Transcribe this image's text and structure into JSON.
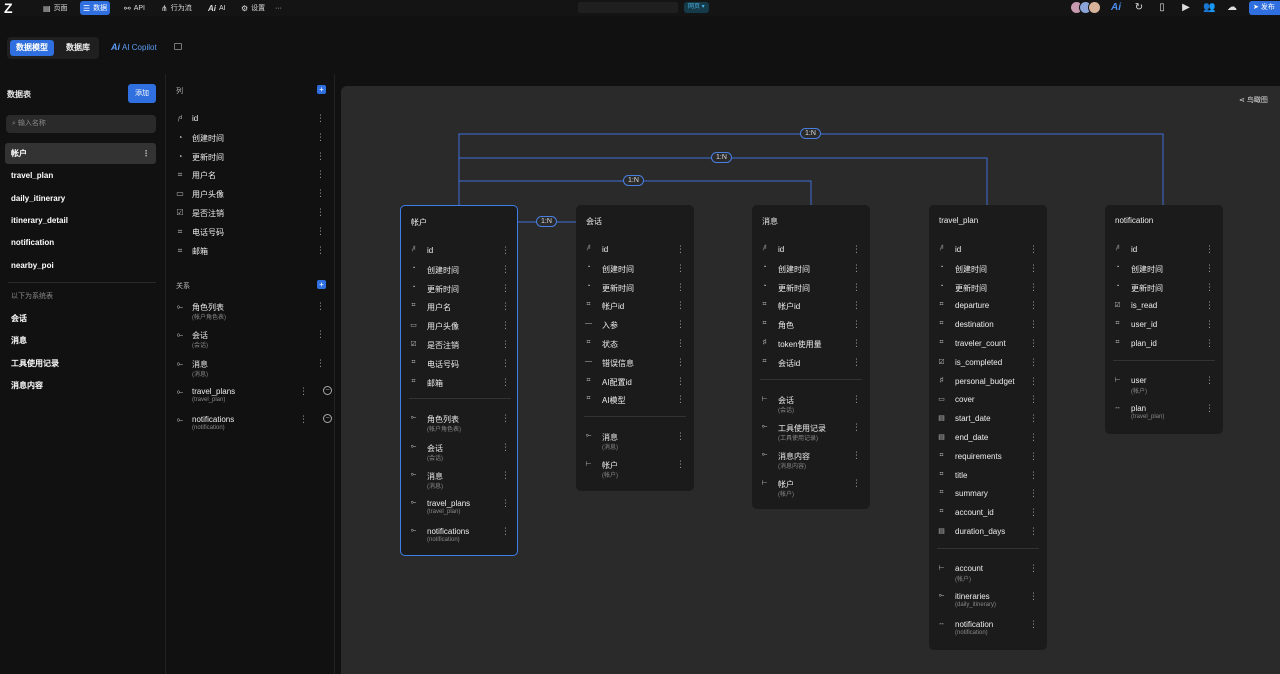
{
  "topbar": {
    "logo": "Z",
    "nav": [
      {
        "id": "page",
        "label": "页面",
        "icon": "layout-icon"
      },
      {
        "id": "data",
        "label": "数据",
        "icon": "database-icon",
        "active": true
      },
      {
        "id": "api",
        "label": "API",
        "icon": "api-icon"
      },
      {
        "id": "flow",
        "label": "行为流",
        "icon": "flow-icon"
      },
      {
        "id": "ai",
        "label": "AI",
        "icon": "ai-icon"
      },
      {
        "id": "settings",
        "label": "设置",
        "icon": "gear-icon"
      }
    ],
    "more": "···",
    "env_badge": "网页",
    "publish_label": "发布",
    "accent": "#2f6fe0"
  },
  "subbar": {
    "tab_model": "数据模型",
    "tab_db": "数据库",
    "copilot_mark": "Ai",
    "copilot_label": "AI Copilot"
  },
  "sidebar": {
    "title": "数据表",
    "add_label": "添加",
    "search_placeholder": "输入名称",
    "tables": [
      "帐户",
      "travel_plan",
      "daily_itinerary",
      "itinerary_detail",
      "notification",
      "nearby_poi"
    ],
    "selected": "帐户",
    "system_note": "以下为系统表",
    "system_tables": [
      "会话",
      "消息",
      "工具使用记录",
      "消息内容"
    ]
  },
  "panel": {
    "columns_title": "列",
    "columns": [
      {
        "icon": "id",
        "name": "id"
      },
      {
        "icon": "time",
        "name": "创建时间"
      },
      {
        "icon": "time",
        "name": "更新时间"
      },
      {
        "icon": "text",
        "name": "用户名"
      },
      {
        "icon": "image",
        "name": "用户头像"
      },
      {
        "icon": "bool",
        "name": "是否注销"
      },
      {
        "icon": "text",
        "name": "电话号码"
      },
      {
        "icon": "text",
        "name": "邮箱"
      }
    ],
    "relations_title": "关系",
    "relations": [
      {
        "name": "角色列表",
        "sub": "(帐户角色表)"
      },
      {
        "name": "会话",
        "sub": "(会话)"
      },
      {
        "name": "消息",
        "sub": "(消息)"
      },
      {
        "name": "travel_plans",
        "sub": "(travel_plan)",
        "removable": true
      },
      {
        "name": "notifications",
        "sub": "(notification)",
        "removable": true
      }
    ]
  },
  "canvas": {
    "birdseye_label": "鸟瞰图",
    "edge_color": "#3d6fd8",
    "badges": [
      "1:N",
      "1:N",
      "1:N",
      "1:N"
    ]
  },
  "cards": [
    {
      "title": "帐户",
      "selected": true,
      "fields": [
        [
          "id",
          "id"
        ],
        [
          "time",
          "创建时间"
        ],
        [
          "time",
          "更新时间"
        ],
        [
          "text",
          "用户名"
        ],
        [
          "image",
          "用户头像"
        ],
        [
          "bool",
          "是否注销"
        ],
        [
          "text",
          "电话号码"
        ],
        [
          "text",
          "邮箱"
        ]
      ],
      "relations": [
        [
          "rel",
          "角色列表",
          "(帐户角色表)"
        ],
        [
          "rel",
          "会话",
          "(会话)"
        ],
        [
          "rel",
          "消息",
          "(消息)"
        ],
        [
          "rel",
          "travel_plans",
          "(travel_plan)"
        ],
        [
          "rel",
          "notifications",
          "(notification)"
        ]
      ]
    },
    {
      "title": "会话",
      "fields": [
        [
          "id",
          "id"
        ],
        [
          "time",
          "创建时间"
        ],
        [
          "time",
          "更新时间"
        ],
        [
          "text",
          "帐户id"
        ],
        [
          "dash",
          "入参"
        ],
        [
          "text",
          "状态"
        ],
        [
          "dash",
          "错误信息"
        ],
        [
          "text",
          "AI配置id"
        ],
        [
          "text",
          "AI模型"
        ]
      ],
      "relations": [
        [
          "rel",
          "消息",
          "(消息)"
        ],
        [
          "ref",
          "帐户",
          "(帐户)"
        ]
      ]
    },
    {
      "title": "消息",
      "fields": [
        [
          "id",
          "id"
        ],
        [
          "time",
          "创建时间"
        ],
        [
          "time",
          "更新时间"
        ],
        [
          "text",
          "帐户id"
        ],
        [
          "text",
          "角色"
        ],
        [
          "num",
          "token使用量"
        ],
        [
          "text",
          "会话id"
        ]
      ],
      "relations": [
        [
          "ref",
          "会话",
          "(会话)"
        ],
        [
          "rel",
          "工具使用记录",
          "(工具使用记录)"
        ],
        [
          "rel",
          "消息内容",
          "(消息内容)"
        ],
        [
          "ref",
          "帐户",
          "(帐户)"
        ]
      ]
    },
    {
      "title": "travel_plan",
      "fields": [
        [
          "id",
          "id"
        ],
        [
          "time",
          "创建时间"
        ],
        [
          "time",
          "更新时间"
        ],
        [
          "text",
          "departure"
        ],
        [
          "text",
          "destination"
        ],
        [
          "text",
          "traveler_count"
        ],
        [
          "bool",
          "is_completed"
        ],
        [
          "num",
          "personal_budget"
        ],
        [
          "image",
          "cover"
        ],
        [
          "date",
          "start_date"
        ],
        [
          "date",
          "end_date"
        ],
        [
          "text",
          "requirements"
        ],
        [
          "text",
          "title"
        ],
        [
          "text",
          "summary"
        ],
        [
          "text",
          "account_id"
        ],
        [
          "date",
          "duration_days"
        ]
      ],
      "relations": [
        [
          "ref",
          "account",
          "(帐户)"
        ],
        [
          "rel",
          "itineraries",
          "(daily_itinerary)"
        ],
        [
          "link",
          "notification",
          "(notification)"
        ]
      ]
    },
    {
      "title": "notification",
      "fields": [
        [
          "id",
          "id"
        ],
        [
          "time",
          "创建时间"
        ],
        [
          "time",
          "更新时间"
        ],
        [
          "bool",
          "is_read"
        ],
        [
          "text",
          "user_id"
        ],
        [
          "text",
          "plan_id"
        ]
      ],
      "relations": [
        [
          "ref",
          "user",
          "(帐户)"
        ],
        [
          "link",
          "plan",
          "(travel_plan)"
        ]
      ]
    }
  ]
}
